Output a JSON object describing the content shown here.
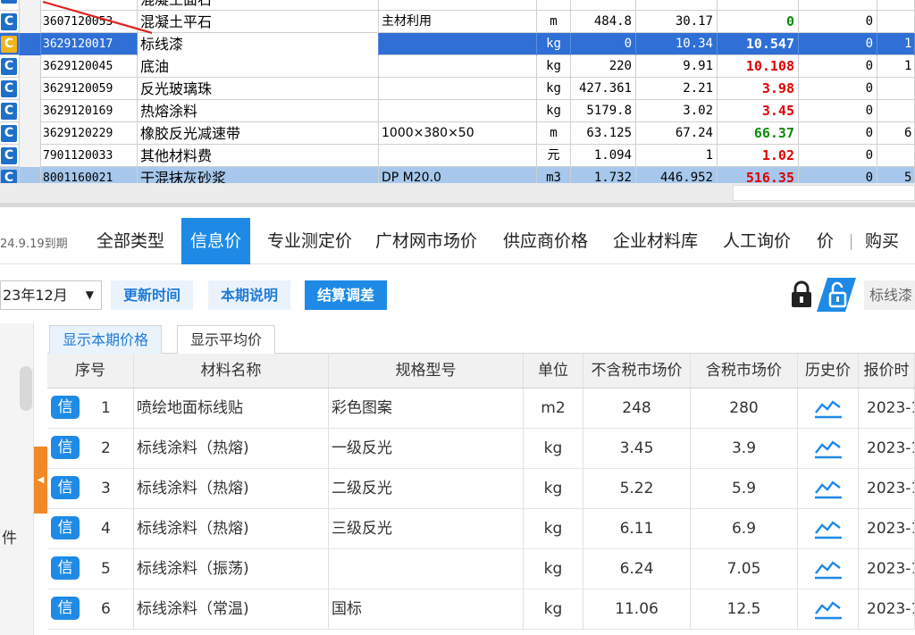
{
  "top_grid": {
    "rows": [
      {
        "type": "C",
        "code": "",
        "name": "混凝土面石",
        "spec": "",
        "unit": "",
        "qty": "",
        "price": "",
        "diff": "",
        "v9": "",
        "v10": "",
        "partial": true
      },
      {
        "type": "C",
        "code": "3607120053",
        "name": "混凝土平石",
        "spec": "主材利用",
        "unit": "m",
        "qty": "484.8",
        "price": "30.17",
        "diff": "0",
        "diff_sign": "pos",
        "v9": "0",
        "v10": ""
      },
      {
        "type": "C",
        "code": "3629120017",
        "name": "标线漆",
        "spec": "",
        "unit": "kg",
        "qty": "0",
        "price": "10.34",
        "diff": "10.547",
        "diff_sign": "none",
        "v9": "0",
        "v10": "1(",
        "selected": true
      },
      {
        "type": "C",
        "code": "3629120045",
        "name": "底油",
        "spec": "",
        "unit": "kg",
        "qty": "220",
        "price": "9.91",
        "diff": "10.108",
        "diff_sign": "neg",
        "v9": "0",
        "v10": "1("
      },
      {
        "type": "C",
        "code": "3629120059",
        "name": "反光玻璃珠",
        "spec": "",
        "unit": "kg",
        "qty": "427.361",
        "price": "2.21",
        "diff": "3.98",
        "diff_sign": "neg",
        "v9": "0",
        "v10": ""
      },
      {
        "type": "C",
        "code": "3629120169",
        "name": "热熔涂料",
        "spec": "",
        "unit": "kg",
        "qty": "5179.8",
        "price": "3.02",
        "diff": "3.45",
        "diff_sign": "neg",
        "v9": "0",
        "v10": ""
      },
      {
        "type": "C",
        "code": "3629120229",
        "name": "橡胶反光减速带",
        "spec": "1000×380×50",
        "unit": "m",
        "qty": "63.125",
        "price": "67.24",
        "diff": "66.37",
        "diff_sign": "pos",
        "v9": "0",
        "v10": "6"
      },
      {
        "type": "C",
        "code": "7901120033",
        "name": "其他材料费",
        "spec": "",
        "unit": "元",
        "qty": "1.094",
        "price": "1",
        "diff": "1.02",
        "diff_sign": "neg",
        "v9": "0",
        "v10": ""
      },
      {
        "type": "C",
        "code": "8001160021",
        "name": "干混抹灰砂浆",
        "spec": "DP M20.0",
        "unit": "m3",
        "qty": "1.732",
        "price": "446.952",
        "diff": "516.35",
        "diff_sign": "neg",
        "v9": "0",
        "v10": "5",
        "highlight": true
      }
    ]
  },
  "tabs": {
    "date_info": "24.9.19到期",
    "items": [
      "全部类型",
      "信息价",
      "专业测定价",
      "广材网市场价",
      "供应商价格",
      "企业材料库",
      "人工询价",
      "价"
    ],
    "active": 1,
    "buy": "购买"
  },
  "toolbar": {
    "period": "23年12月",
    "update_time": "更新时间",
    "period_notes": "本期说明",
    "settle_diff": "结算调差",
    "search_placeholder": "标线漆"
  },
  "left_panel": {
    "label": "件"
  },
  "sub_tabs": {
    "current": "显示本期价格",
    "average": "显示平均价"
  },
  "price_table": {
    "headers": [
      "序号",
      "材料名称",
      "规格型号",
      "单位",
      "不含税市场价",
      "含税市场价",
      "历史价",
      "报价时"
    ],
    "badge": "信",
    "rows": [
      {
        "seq": "1",
        "name": "喷绘地面标线贴",
        "spec": "彩色图案",
        "unit": "m2",
        "ex_tax": "248",
        "inc_tax": "280",
        "date": "2023-1"
      },
      {
        "seq": "2",
        "name": "标线涂料（热熔)",
        "spec": "一级反光",
        "unit": "kg",
        "ex_tax": "3.45",
        "inc_tax": "3.9",
        "date": "2023-1"
      },
      {
        "seq": "3",
        "name": "标线涂料（热熔)",
        "spec": "二级反光",
        "unit": "kg",
        "ex_tax": "5.22",
        "inc_tax": "5.9",
        "date": "2023-1"
      },
      {
        "seq": "4",
        "name": "标线涂料（热熔)",
        "spec": "三级反光",
        "unit": "kg",
        "ex_tax": "6.11",
        "inc_tax": "6.9",
        "date": "2023-1"
      },
      {
        "seq": "5",
        "name": "标线涂料（振荡)",
        "spec": "",
        "unit": "kg",
        "ex_tax": "6.24",
        "inc_tax": "7.05",
        "date": "2023-1"
      },
      {
        "seq": "6",
        "name": "标线涂料（常温)",
        "spec": "国标",
        "unit": "kg",
        "ex_tax": "11.06",
        "inc_tax": "12.5",
        "date": "2023-1"
      }
    ]
  },
  "colors": {
    "accent": "#1e8ae6",
    "selected_row": "#2f6fd6",
    "highlight_row": "#a7c8ec",
    "positive": "#0a8a0a",
    "negative": "#e00000",
    "orange": "#f08a28"
  },
  "icons": [
    "lock-icon",
    "unlock-icon",
    "trend-chart-icon",
    "red-arrow-annotation",
    "dropdown-arrow-icon"
  ]
}
